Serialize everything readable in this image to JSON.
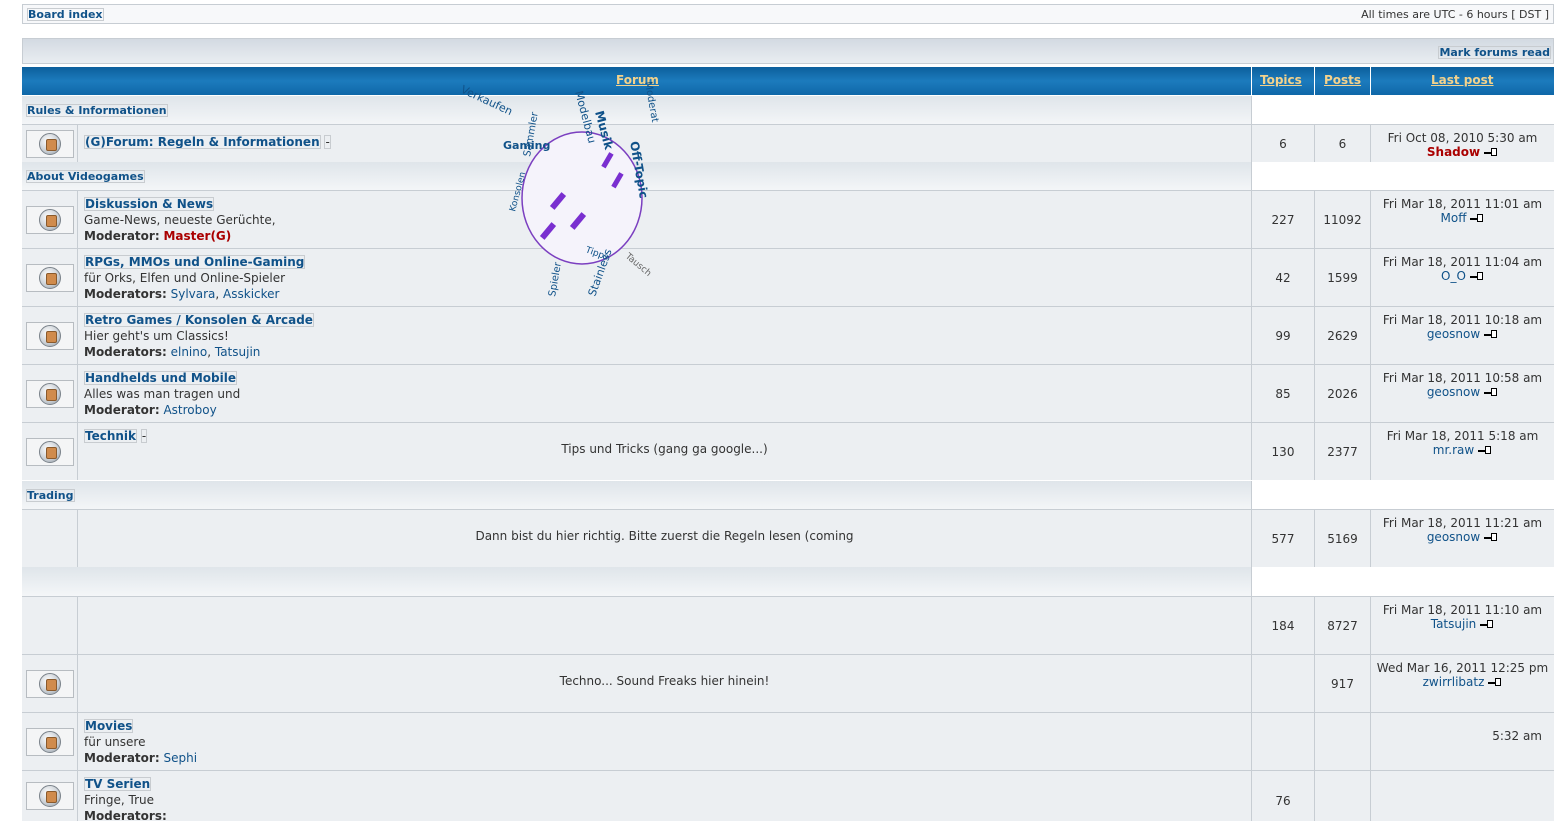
{
  "topbar": {
    "board_index": "Board index",
    "timezone": "All times are UTC - 6 hours [ DST ]"
  },
  "mark_read": "Mark forums read",
  "header": {
    "forum": "Forum",
    "topics": "Topics",
    "posts": "Posts",
    "last_post": "Last post"
  },
  "categories": {
    "rules": "Rules & Informationen",
    "videogames": "About Videogames",
    "trading": "Trading"
  },
  "forums": {
    "f1": {
      "title": "(G)Forum: Regeln & Informationen",
      "suffix": "-",
      "topics": "6",
      "posts": "6",
      "last_date": "Fri Oct 08, 2010 5:30 am",
      "last_user": "Shadow"
    },
    "f2": {
      "title": "Diskussion & News",
      "desc": "Game-News, neueste Gerüchte,",
      "mod_label": "Moderator:",
      "mods": "Master(G)",
      "topics": "227",
      "posts": "11092",
      "last_date": "Fri Mar 18, 2011 11:01 am",
      "last_user": "Moff"
    },
    "f3": {
      "title": "RPGs, MMOs und Online-Gaming",
      "desc": "für Orks, Elfen und Online-Spieler",
      "mod_label": "Moderators:",
      "mod1": "Sylvara",
      "mod2": "Asskicker",
      "topics": "42",
      "posts": "1599",
      "last_date": "Fri Mar 18, 2011 11:04 am",
      "last_user": "O_O"
    },
    "f4": {
      "title": "Retro Games / Konsolen & Arcade",
      "desc": "Hier geht's um Classics!",
      "mod_label": "Moderators:",
      "mod1": "elnino",
      "mod2": "Tatsujin",
      "topics": "99",
      "posts": "2629",
      "last_date": "Fri Mar 18, 2011 10:18 am",
      "last_user": "geosnow"
    },
    "f5": {
      "title": "Handhelds und Mobile",
      "desc": "Alles was man tragen und",
      "mod_label": "Moderator:",
      "mods": "Astroboy",
      "topics": "85",
      "posts": "2026",
      "last_date": "Fri Mar 18, 2011 10:58 am",
      "last_user": "geosnow"
    },
    "f6": {
      "title": "Technik",
      "suffix": "-",
      "center": "Tips und Tricks (gang ga google...)",
      "topics": "130",
      "posts": "2377",
      "last_date": "Fri Mar 18, 2011 5:18 am",
      "last_user": "mr.raw"
    },
    "f7": {
      "center": "Dann bist du hier richtig. Bitte zuerst die Regeln lesen (coming",
      "topics": "577",
      "posts": "5169",
      "last_date": "Fri Mar 18, 2011 11:21 am",
      "last_user": "geosnow"
    },
    "f8": {
      "topics": "184",
      "posts": "8727",
      "last_date": "Fri Mar 18, 2011 11:10 am",
      "last_user": "Tatsujin"
    },
    "f9": {
      "center": "Techno... Sound Freaks hier hinein!",
      "posts": "917",
      "last_date": "Wed Mar 16, 2011 12:25 pm",
      "last_user": "zwirrlibatz"
    },
    "f10": {
      "title": "Movies",
      "desc": "für unsere",
      "mod_label": "Moderator:",
      "mods": "Sephi",
      "last_date": "5:32 am"
    },
    "f11": {
      "title": "TV Serien",
      "desc": "Fringe, True",
      "mod_label": "Moderators:",
      "topics": "76"
    }
  },
  "cloud": {
    "w1": "Verkaufen",
    "w2": "Modelbau",
    "w3": "Musik",
    "w4": "Off-Topic",
    "w5": "Gaming",
    "w6": "Stainless",
    "w7": "Moderat",
    "w8": "Spieler",
    "w9": "Tausch",
    "w10": "Sammler",
    "w11": "Konsolen",
    "w12": "Tipps"
  }
}
